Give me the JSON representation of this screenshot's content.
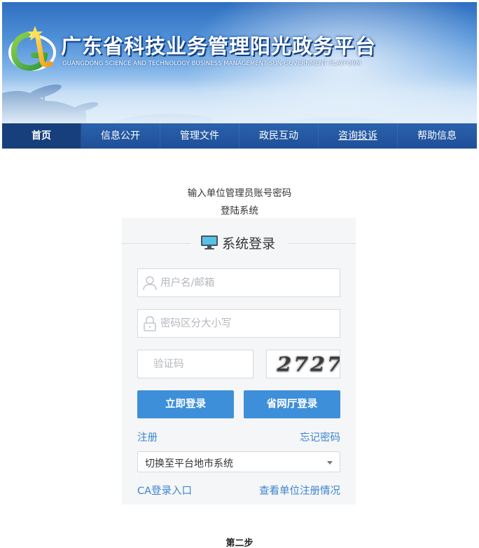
{
  "banner": {
    "title": "广东省科技业务管理阳光政务平台",
    "subtitle": "GUANGDONG SCIENCE AND TECHNOLOGY BUSINESS MANAGEMENT SUN-GOVERNMENT PLATFORM",
    "logo_text": "G"
  },
  "nav": {
    "items": [
      {
        "label": "首页"
      },
      {
        "label": "信息公开"
      },
      {
        "label": "管理文件"
      },
      {
        "label": "政民互动"
      },
      {
        "label": "咨询投诉"
      },
      {
        "label": "帮助信息"
      }
    ]
  },
  "instructions": {
    "line1": "输入单位管理员账号密码",
    "line2": "登陆系统"
  },
  "login": {
    "title": "系统登录",
    "username_placeholder": "用户名/邮箱",
    "password_placeholder": "密码区分大小写",
    "captcha_placeholder": "验证码",
    "captcha_text": "2727",
    "login_button": "立即登录",
    "gov_login_button": "省网厅登录",
    "register_link": "注册",
    "forgot_link": "忘记密码",
    "city_select": "切换至平台地市系统",
    "ca_link": "CA登录入口",
    "check_link": "查看单位注册情况"
  },
  "footer": {
    "step": "第二步"
  },
  "colors": {
    "nav": "#1f4f97",
    "button": "#3d8fd9",
    "link": "#3b84cf",
    "panel": "#f5f6f8"
  }
}
